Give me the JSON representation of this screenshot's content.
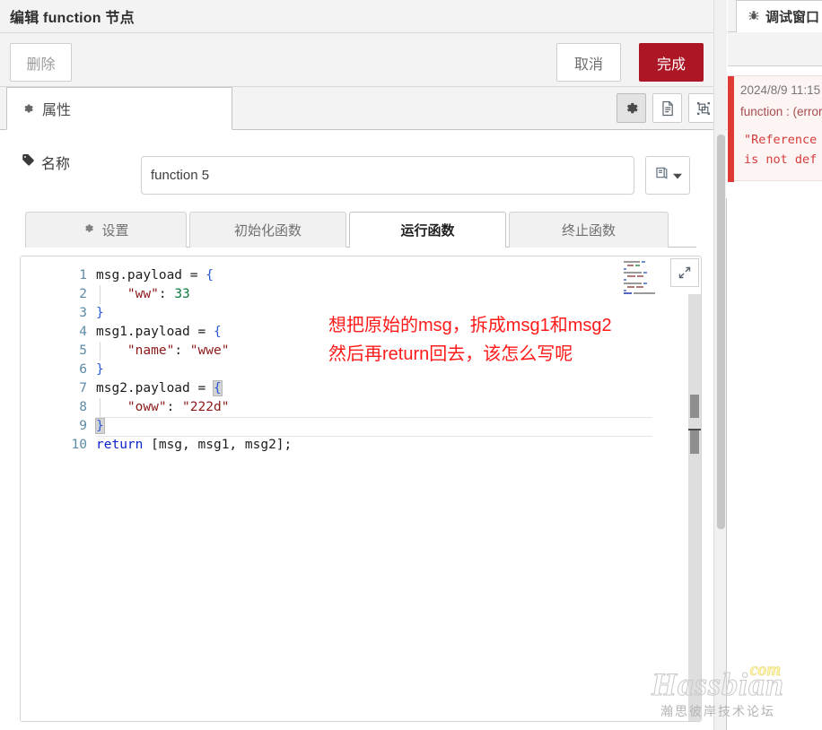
{
  "dialog": {
    "title": "编辑 function 节点",
    "buttons": {
      "delete": "删除",
      "cancel": "取消",
      "done": "完成"
    },
    "tabs": [
      {
        "label": "属性",
        "icon": "gear-icon",
        "active": true
      }
    ],
    "toolbar_icons": [
      {
        "name": "gear-icon",
        "active": true
      },
      {
        "name": "document-icon",
        "active": false
      },
      {
        "name": "layout-icon",
        "active": false
      }
    ],
    "name_field": {
      "label": "名称",
      "icon": "tag-icon",
      "value": "function 5",
      "placeholder": "名称",
      "menu_icon": "book-icon",
      "menu_chevron": "chevron-down-icon"
    },
    "function_tabs": [
      {
        "label": "设置",
        "icon": "gear-icon",
        "active": false
      },
      {
        "label": "初始化函数",
        "icon": "",
        "active": false
      },
      {
        "label": "运行函数",
        "icon": "",
        "active": true
      },
      {
        "label": "终止函数",
        "icon": "",
        "active": false
      }
    ]
  },
  "editor": {
    "expand_icon": "expand-icon",
    "line_numbers": [
      "1",
      "2",
      "3",
      "4",
      "5",
      "6",
      "7",
      "8",
      "9",
      "10"
    ],
    "lines": [
      {
        "n": "1",
        "text": "msg.payload = {"
      },
      {
        "n": "2",
        "text": "    \"ww\": 33"
      },
      {
        "n": "3",
        "text": "}"
      },
      {
        "n": "4",
        "text": "msg1.payload = {"
      },
      {
        "n": "5",
        "text": "    \"name\": \"wwe\""
      },
      {
        "n": "6",
        "text": "}"
      },
      {
        "n": "7",
        "text": "msg2.payload = {"
      },
      {
        "n": "8",
        "text": "    \"oww\": \"222d\""
      },
      {
        "n": "9",
        "text": "}"
      },
      {
        "n": "10",
        "text": "return [msg, msg1, msg2];"
      }
    ],
    "annotation": "想把原始的msg，拆成msg1和msg2\n然后再return回去，该怎么写呢",
    "annotation_color": "#ff1a1a"
  },
  "debug": {
    "tab_label": "调试窗口",
    "tab_icon": "bug-icon",
    "message": {
      "timestamp": "2024/8/9 11:15",
      "source": "function : (error)",
      "body": "\"Reference\nis not def"
    },
    "accent_color": "#e03a36"
  },
  "watermark": {
    "main": "Hassbian",
    "tld": "com",
    "sub": "瀚思彼岸技术论坛"
  }
}
